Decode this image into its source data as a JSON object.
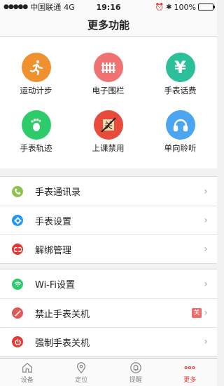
{
  "status_bar": {
    "carrier": "中国联通",
    "network": "4G",
    "time": "19:16",
    "battery": "100%"
  },
  "nav": {
    "title": "更多功能"
  },
  "grid": [
    {
      "label": "运动计步",
      "color": "#f0912f",
      "icon": "running-man-icon"
    },
    {
      "label": "电子围栏",
      "color": "#f07272",
      "icon": "fence-icon"
    },
    {
      "label": "手表话费",
      "color": "#2bbf9a",
      "icon": "yuan-icon"
    },
    {
      "label": "手表轨迹",
      "color": "#2ecb6a",
      "icon": "footprint-icon"
    },
    {
      "label": "上课禁用",
      "color": "#e64b3c",
      "icon": "class-disable-icon"
    },
    {
      "label": "单向聆听",
      "color": "#4aa6f0",
      "icon": "headphones-icon"
    }
  ],
  "group1": [
    {
      "label": "手表通讯录",
      "color": "#8bc34a",
      "icon": "phone-book-icon"
    },
    {
      "label": "手表设置",
      "color": "#2196f3",
      "icon": "gear-icon"
    },
    {
      "label": "解绑管理",
      "color": "#e53935",
      "icon": "unbind-icon"
    }
  ],
  "group2": [
    {
      "label": "Wi-Fi设置",
      "color": "#2ecb6a",
      "icon": "wifi-icon"
    },
    {
      "label": "禁止手表关机",
      "color": "#e05a5a",
      "icon": "forbid-icon",
      "badge": "关"
    },
    {
      "label": "强制手表关机",
      "color": "#e53935",
      "icon": "power-icon"
    }
  ],
  "tabs": [
    {
      "label": "设备",
      "icon": "house-icon"
    },
    {
      "label": "定位",
      "icon": "location-pin-icon"
    },
    {
      "label": "提醒",
      "icon": "bell-icon"
    },
    {
      "label": "更多",
      "icon": "more-dots-icon",
      "active": true
    }
  ]
}
